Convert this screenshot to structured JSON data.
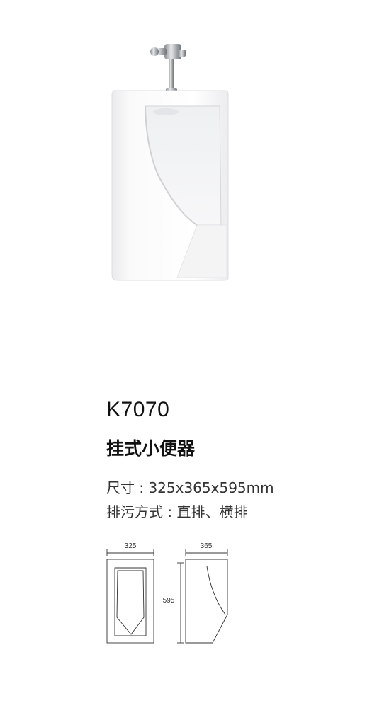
{
  "product": {
    "model": "K7070",
    "name": "挂式小便器",
    "size_line": "尺寸 : 325x365x595mm",
    "drain_line": "排污方式 : 直排、横排"
  },
  "dimensions": {
    "width": "325",
    "depth": "365",
    "height": "595"
  }
}
